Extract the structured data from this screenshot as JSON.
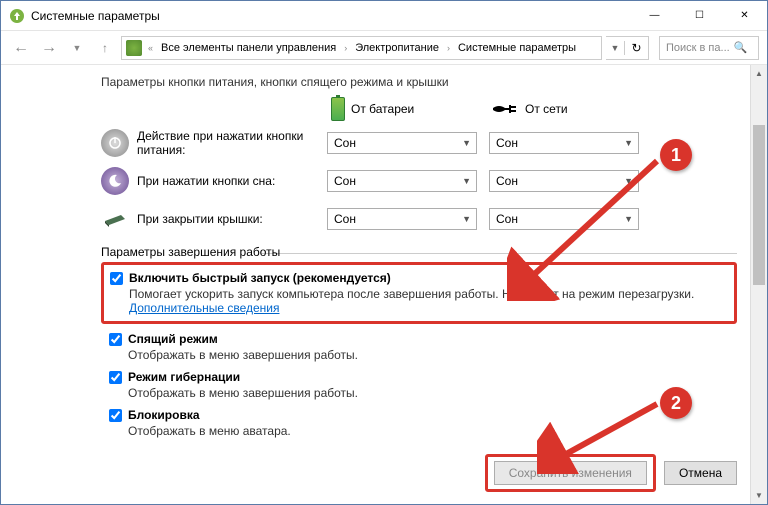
{
  "window": {
    "title": "Системные параметры"
  },
  "nav": {
    "breadcrumb": [
      "Все элементы панели управления",
      "Электропитание",
      "Системные параметры"
    ],
    "search_placeholder": "Поиск в па..."
  },
  "section1": {
    "title": "Параметры кнопки питания, кнопки спящего режима и крышки",
    "col_battery": "От батареи",
    "col_ac": "От сети",
    "rows": [
      {
        "label": "Действие при нажатии кнопки питания:",
        "battery": "Сон",
        "ac": "Сон"
      },
      {
        "label": "При нажатии кнопки сна:",
        "battery": "Сон",
        "ac": "Сон"
      },
      {
        "label": "При закрытии крышки:",
        "battery": "Сон",
        "ac": "Сон"
      }
    ]
  },
  "section2": {
    "title": "Параметры завершения работы",
    "fast_startup": {
      "label": "Включить быстрый запуск (рекомендуется)",
      "desc_pre": "Помогает ускорить запуск компьютера после завершения работы. Не влияет на режим перезагрузки. ",
      "link": "Дополнительные сведения"
    },
    "sleep": {
      "label": "Спящий режим",
      "desc": "Отображать в меню завершения работы."
    },
    "hibernate": {
      "label": "Режим гибернации",
      "desc": "Отображать в меню завершения работы."
    },
    "lock": {
      "label": "Блокировка",
      "desc": "Отображать в меню аватара."
    }
  },
  "buttons": {
    "save": "Сохранить изменения",
    "cancel": "Отмена"
  },
  "callouts": {
    "one": "1",
    "two": "2"
  }
}
